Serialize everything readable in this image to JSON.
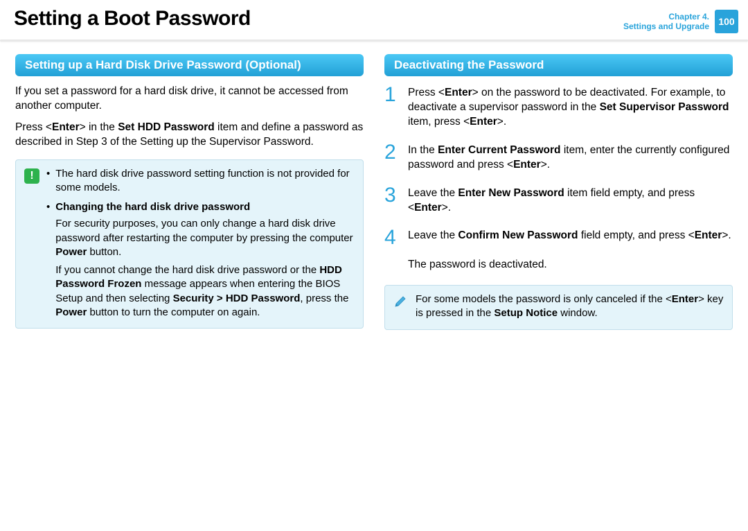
{
  "header": {
    "title": "Setting a Boot Password",
    "chapter_line1": "Chapter 4.",
    "chapter_line2": "Settings and Upgrade",
    "page_number": "100"
  },
  "left": {
    "heading": "Setting up a Hard Disk Drive Password (Optional)",
    "para1": "If you set a password for a hard disk drive, it cannot be accessed from another computer.",
    "para2_html": "Press <<b>Enter</b>> in the <b>Set HDD Password</b> item and define a password as described in Step 3 of the Setting up the Supervisor Password.",
    "note": {
      "item1": "The hard disk drive password setting function is not provided for some models.",
      "item2_title": "Changing the hard disk drive password",
      "item2_p1_html": "For security purposes, you can only change a hard disk drive password after restarting the computer by pressing the computer <b>Power</b> button.",
      "item2_p2_html": "If you cannot change the hard disk drive password or the <b>HDD Password Frozen</b> message appears when entering the BIOS Setup and then selecting <b>Security > HDD Password</b>, press the <b>Power</b> button to turn the computer on again."
    }
  },
  "right": {
    "heading": "Deactivating the Password",
    "steps": [
      {
        "num": "1",
        "html": "Press <<b>Enter</b>> on the password to be deactivated. For example, to deactivate a supervisor password in the <b>Set Supervisor Password</b> item, press <<b>Enter</b>>."
      },
      {
        "num": "2",
        "html": "In the <b>Enter Current Password</b> item, enter the currently configured password and press <<b>Enter</b>>."
      },
      {
        "num": "3",
        "html": "Leave the <b>Enter New Password</b> item field empty, and press <<b>Enter</b>>."
      },
      {
        "num": "4",
        "html": "Leave the <b>Confirm New Password</b> field empty, and press <<b>Enter</b>>.<br><br>The password is deactivated."
      }
    ],
    "tip_html": "For some models the password is only canceled if the <<b>Enter</b>> key is pressed in the <b>Setup Notice</b> window."
  }
}
